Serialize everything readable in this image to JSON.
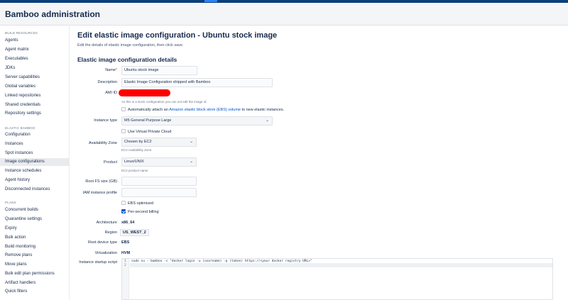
{
  "header": {
    "title": "Bamboo administration"
  },
  "sidebar": {
    "groups": [
      {
        "heading": "BUILD RESOURCES",
        "items": [
          "Agents",
          "Agent matrix",
          "Executables",
          "JDKs",
          "Server capabilities",
          "Global variables",
          "Linked repositories",
          "Shared credentials",
          "Repository settings"
        ]
      },
      {
        "heading": "ELASTIC BAMBOO",
        "items": [
          "Configuration",
          "Instances",
          "Spot instances",
          "Image configurations",
          "Instance schedules",
          "Agent history",
          "Disconnected instances"
        ]
      },
      {
        "heading": "PLANS",
        "items": [
          "Concurrent builds",
          "Quarantine settings",
          "Expiry",
          "Bulk action",
          "Build monitoring",
          "Remove plans",
          "Move plans",
          "Bulk edit plan permissions",
          "Artifact handlers",
          "Quick filters"
        ]
      }
    ],
    "active_item": "Image configurations"
  },
  "page": {
    "title": "Edit elastic image configuration - Ubuntu stock image",
    "description": "Edit the details of elastic image configuration, then click save.",
    "section_title": "Elastic image configuration details"
  },
  "form": {
    "name": {
      "label": "Name",
      "required_mark": "*",
      "value": "Ubuntu stock image"
    },
    "description": {
      "label": "Description",
      "value": "Elastic Image Configuration shipped with Bamboo"
    },
    "ami_id": {
      "label": "AMI ID",
      "help": "As this is a stock configuration you can not edit the image id."
    },
    "ebs_attach": {
      "prefix": "Automatically attach an ",
      "link": "Amazon elastic block store (EBS) volume",
      "suffix": " to new elastic instances.",
      "checked": false
    },
    "instance_type": {
      "label": "Instance type",
      "value": "M5 General Purpose Large"
    },
    "vpc": {
      "label": "Use Virtual Private Cloud",
      "checked": false
    },
    "availability_zone": {
      "label": "Availability Zone",
      "value": "Chosen by EC2",
      "help": "EC2 Availability Zone"
    },
    "product": {
      "label": "Product",
      "value": "Linux/UNIX",
      "help": "EC2 product name"
    },
    "root_fs": {
      "label": "Root FS size (GB)",
      "value": ""
    },
    "iam_profile": {
      "label": "IAM instance profile",
      "value": ""
    },
    "ebs_optimised": {
      "label": "EBS optimised",
      "checked": false
    },
    "per_second_billing": {
      "label": "Per-second billing",
      "checked": true
    },
    "architecture": {
      "label": "Architecture",
      "value": "x86_64"
    },
    "region": {
      "label": "Region",
      "value": "US_WEST_2"
    },
    "root_device_type": {
      "label": "Root device type",
      "value": "EBS"
    },
    "virtualization": {
      "label": "Virtualization",
      "value": "HVM"
    },
    "startup_script": {
      "label": "Instance startup script",
      "lines": [
        "sudo su - bamboo -c \"docker login -u (username) -p (token) https://<your docker registry URL>\"",
        ""
      ],
      "line_numbers": [
        "1",
        "2"
      ]
    }
  }
}
